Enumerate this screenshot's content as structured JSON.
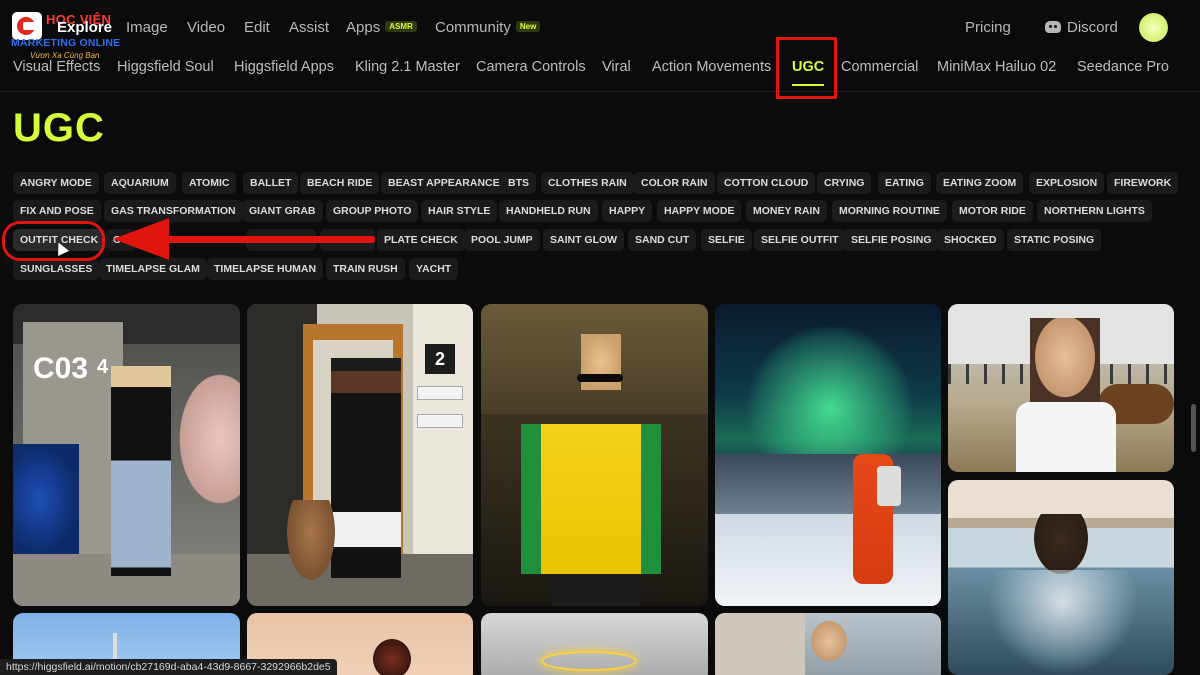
{
  "logo": {
    "line1": "HỌC VIỆN",
    "line2": "MARKETING ONLINE",
    "line3": "Vươn Xa Cùng Bạn"
  },
  "topnav": {
    "explore": "Explore",
    "image": "Image",
    "video": "Video",
    "edit": "Edit",
    "assist": "Assist",
    "apps": "Apps",
    "apps_badge": "ASMR",
    "community": "Community",
    "community_badge": "New",
    "pricing": "Pricing",
    "discord": "Discord"
  },
  "subtabs": [
    "Visual Effects",
    "Higgsfield Soul",
    "Higgsfield Apps",
    "Kling 2.1 Master",
    "Camera Controls",
    "Viral",
    "Action Movements",
    "UGC",
    "Commercial",
    "MiniMax Hailuo 02",
    "Seedance Pro"
  ],
  "active_subtab": "UGC",
  "page_title": "UGC",
  "chips": [
    "ANGRY MODE",
    "AQUARIUM",
    "ATOMIC",
    "BALLET",
    "BEACH RIDE",
    "BEAST APPEARANCE",
    "BTS",
    "CLOTHES RAIN",
    "COLOR RAIN",
    "COTTON CLOUD",
    "CRYING",
    "EATING",
    "EATING ZOOM",
    "EXPLOSION",
    "FIREWORK",
    "FIX AND POSE",
    "GAS TRANSFORMATION",
    "GIANT GRAB",
    "GROUP PHOTO",
    "HAIR STYLE",
    "HANDHELD RUN",
    "HAPPY",
    "HAPPY MODE",
    "MONEY RAIN",
    "MORNING ROUTINE",
    "MOTOR RIDE",
    "NORTHERN LIGHTS",
    "OUTFIT CHECK",
    "OU",
    "",
    "",
    "PLATE CHECK",
    "POOL JUMP",
    "SAINT GLOW",
    "SAND CUT",
    "SELFIE",
    "SELFIE OUTFIT",
    "SELFIE POSING",
    "SHOCKED",
    "STATIC POSING",
    "SUNGLASSES",
    "TIMELAPSE GLAM",
    "TIMELAPSE HUMAN",
    "TRAIN RUSH",
    "YACHT"
  ],
  "selected_chip": "OUTFIT CHECK",
  "gallery": {
    "card1_sign": "C03",
    "card1_sign2": "4",
    "card2_sign": "2"
  },
  "status_url": "https://higgsfield.ai/motion/cb27169d-aba4-43d9-8667-3292966b2de5",
  "colors": {
    "accent": "#d6ff3a",
    "annotation": "#e0150f",
    "background": "#0b0b0c"
  }
}
